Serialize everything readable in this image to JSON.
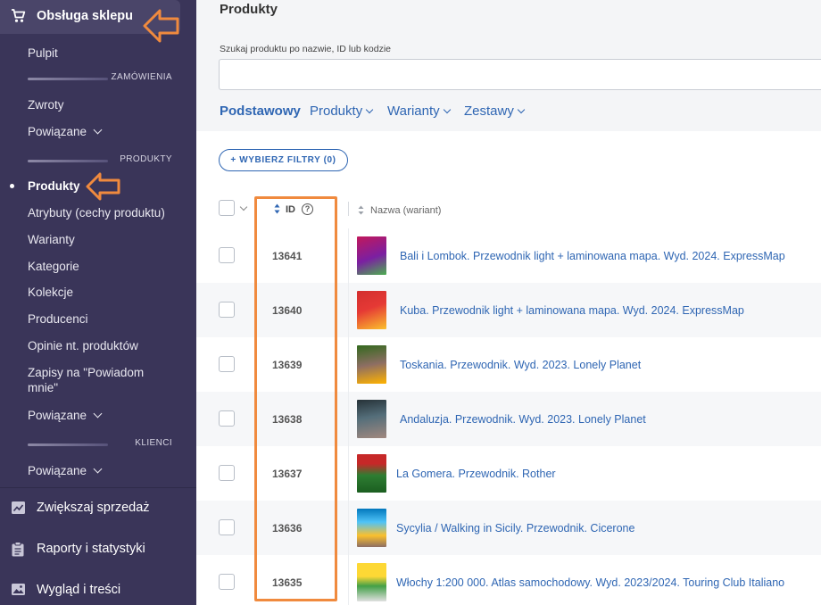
{
  "sidebar": {
    "title": "Obsługa sklepu",
    "items": [
      {
        "label": "Pulpit"
      },
      {
        "section": "ZAMÓWIENIA"
      },
      {
        "label": "Zwroty"
      },
      {
        "label": "Powiązane"
      },
      {
        "section": "PRODUKTY"
      },
      {
        "label": "Produkty"
      },
      {
        "label": "Atrybuty (cechy produktu)"
      },
      {
        "label": "Warianty"
      },
      {
        "label": "Kategorie"
      },
      {
        "label": "Kolekcje"
      },
      {
        "label": "Producenci"
      },
      {
        "label": "Opinie nt. produktów"
      },
      {
        "label": "Zapisy na \"Powiadom mnie\""
      },
      {
        "label": "Powiązane"
      },
      {
        "section": "KLIENCI"
      },
      {
        "label": "Powiązane"
      }
    ],
    "sections": [
      {
        "label": "Zwiększaj sprzedaż",
        "icon": "chart-line-icon"
      },
      {
        "label": "Raporty i statystyki",
        "icon": "clipboard-icon"
      },
      {
        "label": "Wygląd i treści",
        "icon": "image-icon"
      }
    ],
    "active_item": "Produkty",
    "colors": {
      "background": "#3a3559",
      "accent_annotation": "#f08a3e"
    }
  },
  "main": {
    "page_title": "Produkty",
    "search": {
      "label": "Szukaj produktu po nazwie, ID lub kodzie",
      "value": "",
      "placeholder": ""
    },
    "tabs": [
      {
        "label": "Podstawowy"
      },
      {
        "label": "Produkty"
      },
      {
        "label": "Warianty"
      },
      {
        "label": "Zestawy"
      }
    ],
    "filter_button": "+ WYBIERZ FILTRY (0)",
    "table": {
      "columns": {
        "id": "ID",
        "name": "Nazwa (wariant)"
      },
      "rows": [
        {
          "id": "13641",
          "name": "Bali i Lombok. Przewodnik light + laminowana mapa. Wyd. 2024. ExpressMap"
        },
        {
          "id": "13640",
          "name": "Kuba. Przewodnik light + laminowana mapa. Wyd. 2024. ExpressMap"
        },
        {
          "id": "13639",
          "name": "Toskania. Przewodnik. Wyd. 2023. Lonely Planet"
        },
        {
          "id": "13638",
          "name": "Andaluzja. Przewodnik. Wyd. 2023. Lonely Planet"
        },
        {
          "id": "13637",
          "name": "La Gomera. Przewodnik. Rother"
        },
        {
          "id": "13636",
          "name": "Sycylia / Walking in Sicily. Przewodnik. Cicerone"
        },
        {
          "id": "13635",
          "name": "Włochy 1:200 000. Atlas samochodowy. Wyd. 2023/2024. Touring Club Italiano"
        }
      ]
    },
    "colors": {
      "link": "#2f66b3",
      "highlight": "#f08a3e"
    }
  }
}
